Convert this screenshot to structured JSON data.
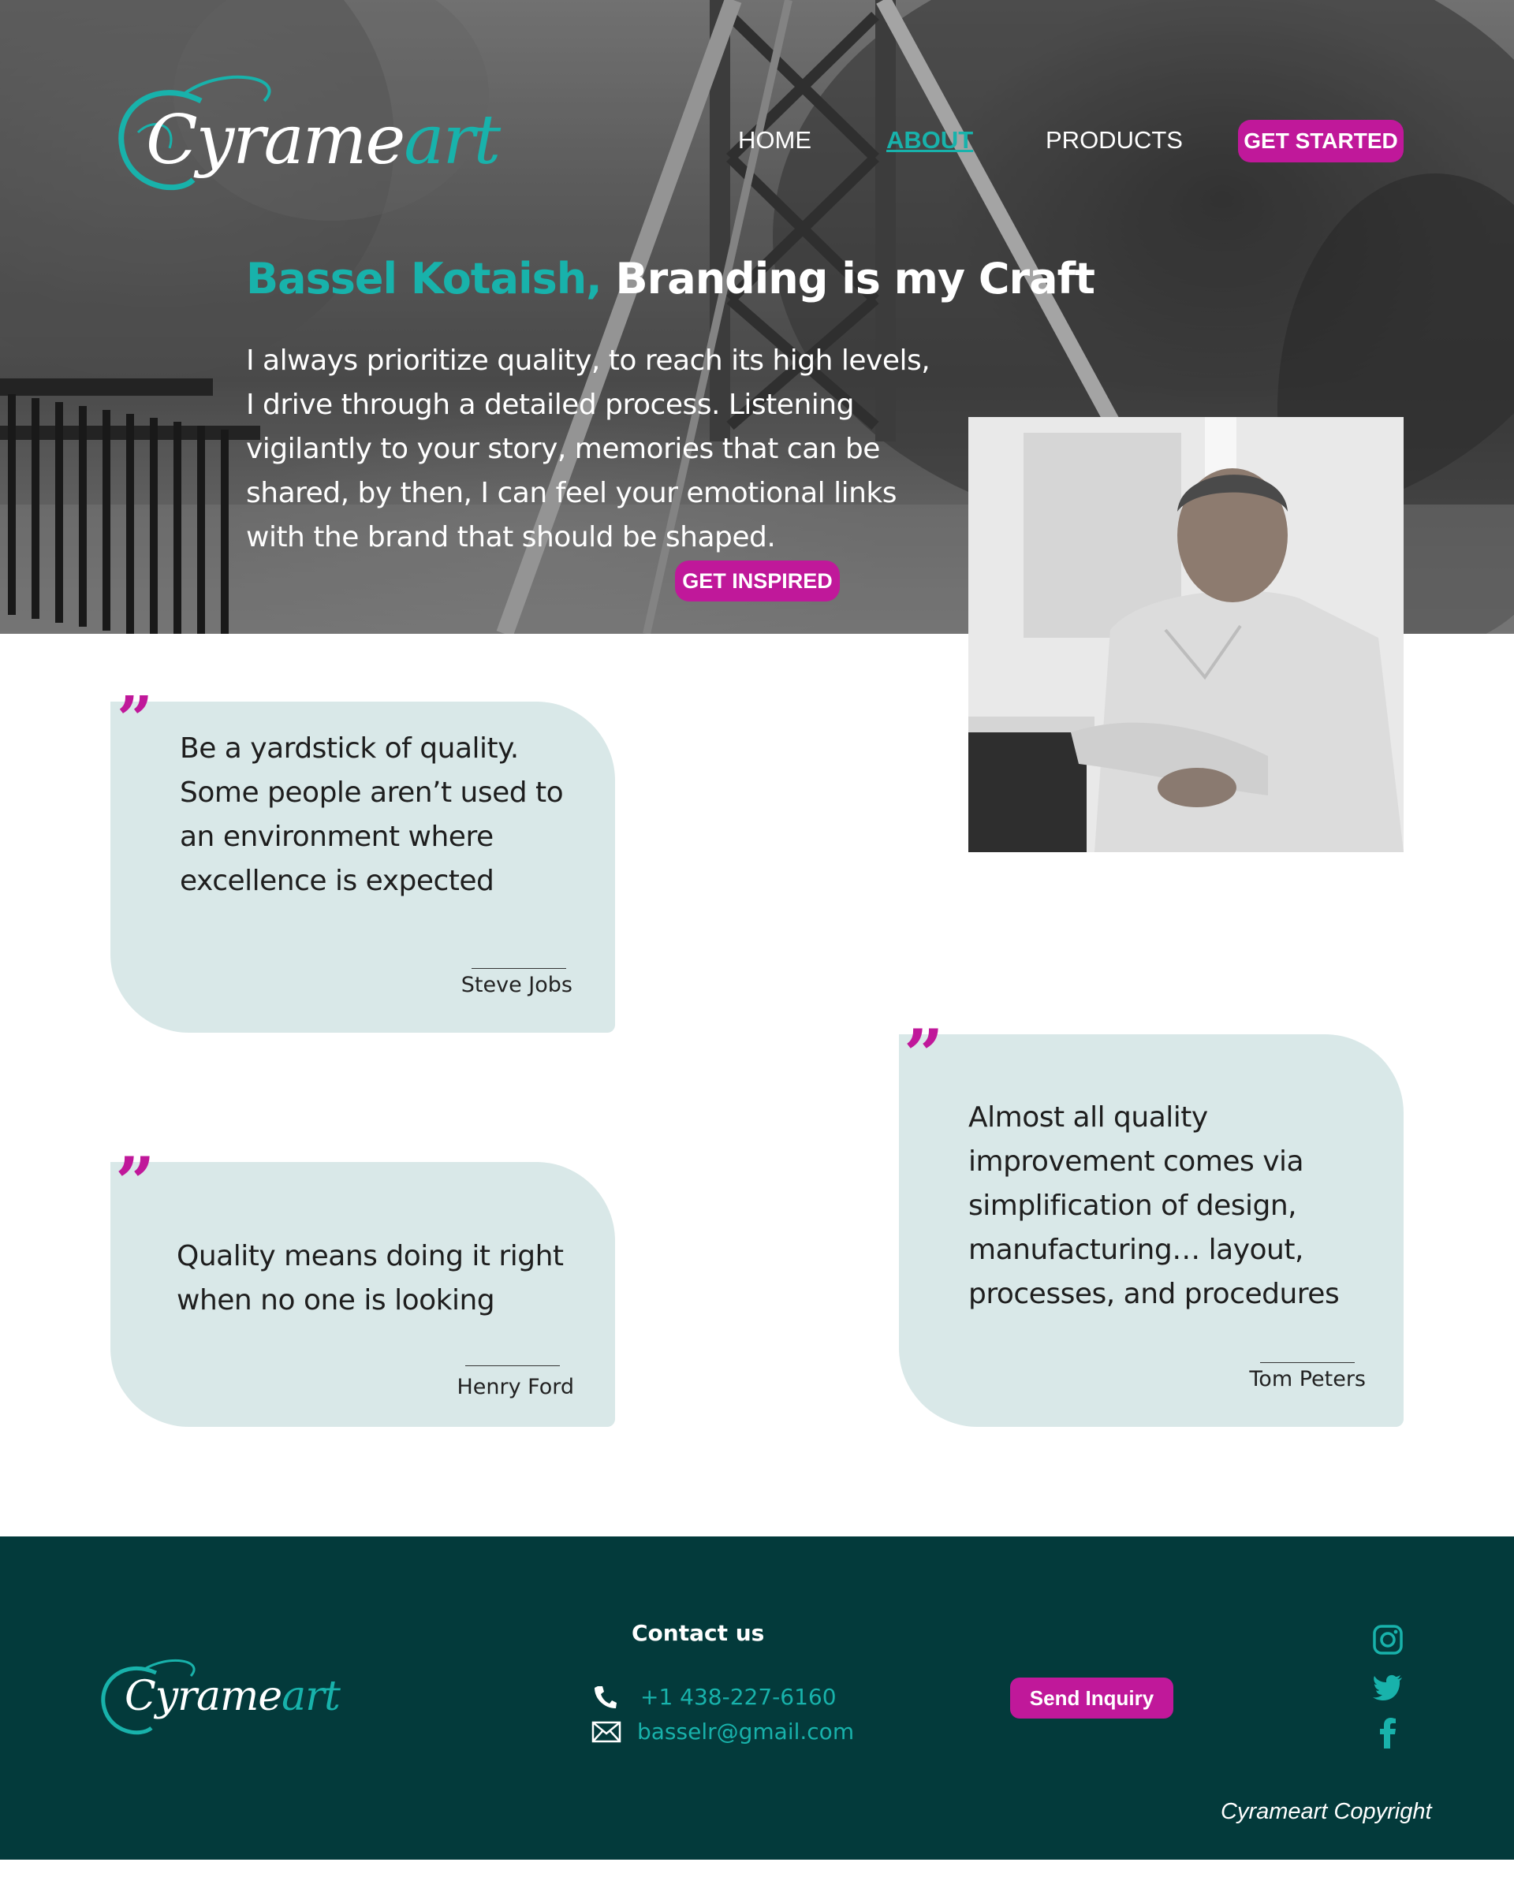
{
  "brand": {
    "logo_text_main": "Cyrame",
    "logo_text_accent": "art",
    "accent_color": "#18b2ab",
    "pink_color": "#c0189a",
    "footer_color": "#033a3b"
  },
  "nav": {
    "items": [
      {
        "label": "HOME"
      },
      {
        "label": "ABOUT"
      },
      {
        "label": "PRODUCTS"
      }
    ],
    "active": "ABOUT",
    "cta_label": "GET STARTED"
  },
  "hero": {
    "name": "Bassel Kotaish,",
    "tagline": " Branding is my Craft",
    "body": "I always prioritize quality, to reach its high levels, I drive through a detailed process. Listening vigilantly to your story, memories that can be shared, by then, I can feel your emotional links with the brand that should be shaped.",
    "cta_label": "GET INSPIRED"
  },
  "quotes": [
    {
      "text": "Be a yardstick of quality. Some people aren’t used to an environment where excellence is expected",
      "author": "Steve Jobs"
    },
    {
      "text": "Almost all quality improvement comes via simplification of design, manufacturing… layout, processes, and procedures",
      "author": "Tom Peters"
    },
    {
      "text": "Quality means doing it right when no one is looking",
      "author": "Henry Ford"
    }
  ],
  "footer": {
    "contact_title": "Contact us",
    "phone": "+1 438-227-6160",
    "email": "basselr@gmail.com",
    "inquiry_label": "Send Inquiry",
    "copyright": "Cyrameart Copyright",
    "social_icons": [
      "instagram-icon",
      "twitter-icon",
      "facebook-icon"
    ]
  }
}
